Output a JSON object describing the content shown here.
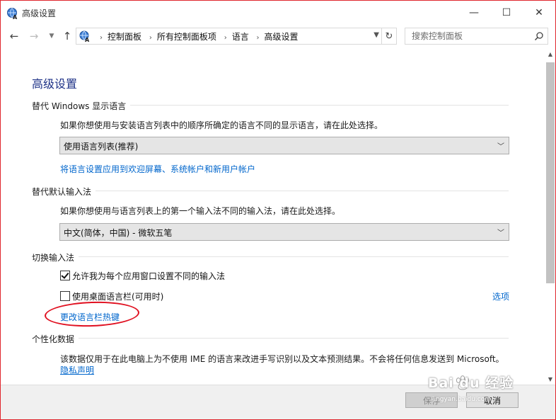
{
  "window": {
    "title": "高级设置",
    "min_symbol": "—",
    "max_symbol": "☐",
    "close_symbol": "✕"
  },
  "nav": {
    "breadcrumbs": [
      "控制面板",
      "所有控制面板项",
      "语言",
      "高级设置"
    ],
    "search_placeholder": "搜索控制面板"
  },
  "page": {
    "title": "高级设置",
    "display_language": {
      "heading": "替代 Windows 显示语言",
      "description": "如果你想使用与安装语言列表中的顺序所确定的语言不同的显示语言，请在此处选择。",
      "selected": "使用语言列表(推荐)",
      "link": "将语言设置应用到欢迎屏幕、系统帐户和新用户帐户"
    },
    "default_input": {
      "heading": "替代默认输入法",
      "description": "如果你想使用与语言列表上的第一个输入法不同的输入法，请在此处选择。",
      "selected": "中文(简体，中国) - 微软五笔"
    },
    "switch_input": {
      "heading": "切换输入法",
      "checkbox1_label": "允许我为每个应用窗口设置不同的输入法",
      "checkbox1_checked": true,
      "checkbox2_label": "使用桌面语言栏(可用时)",
      "checkbox2_checked": false,
      "options_link": "选项",
      "hotkey_link": "更改语言栏热键"
    },
    "personalization": {
      "heading": "个性化数据",
      "description": "该数据仅用于在此电脑上为不使用 IME 的语言来改进手写识别以及文本预测结果。不会将任何信息发送到 Microsoft。",
      "privacy_link": "隐私声明"
    }
  },
  "footer": {
    "ok_label": "保存",
    "cancel_label": "取消"
  },
  "watermark": {
    "text": "Bai du 经验",
    "sub": "jingyan.baidu.com"
  },
  "colors": {
    "title_blue": "#1e3287",
    "link_blue": "#0066cc",
    "annotation_red": "#e01020"
  }
}
